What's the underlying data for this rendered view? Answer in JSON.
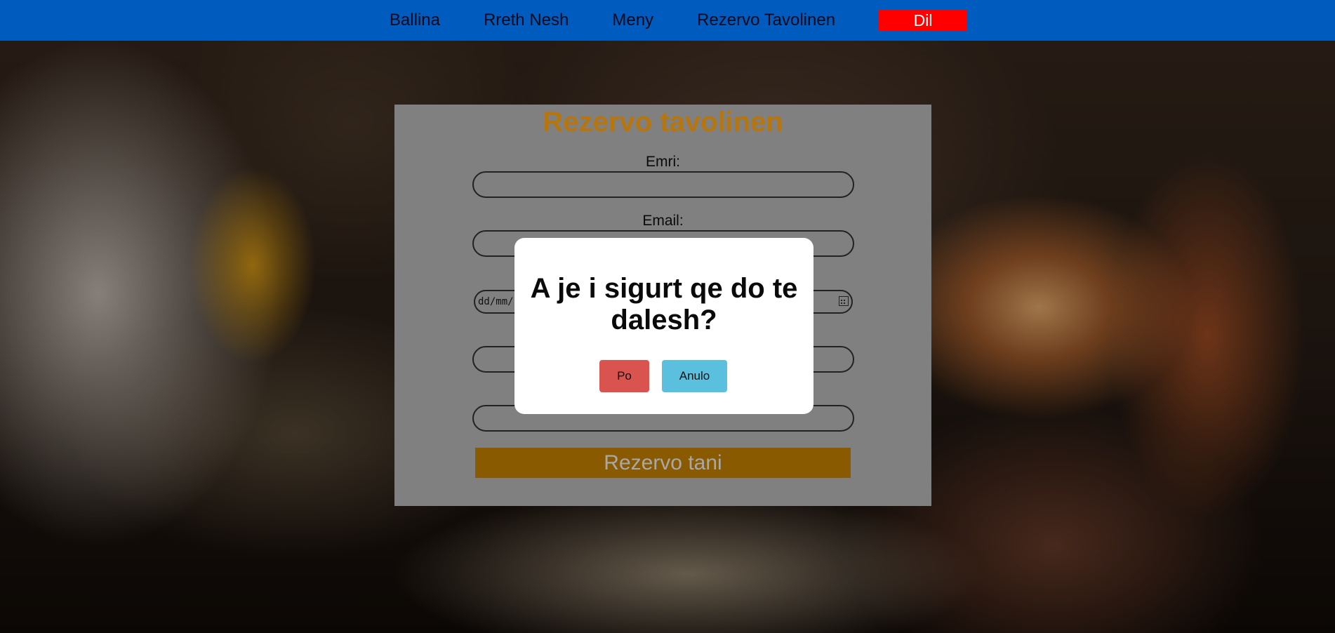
{
  "nav": {
    "items": [
      {
        "label": "Ballina"
      },
      {
        "label": "Rreth Nesh"
      },
      {
        "label": "Meny"
      },
      {
        "label": "Rezervo Tavolinen"
      }
    ],
    "logout_label": "Dil"
  },
  "form": {
    "title": "Rezervo tavolinen",
    "name_label": "Emri:",
    "email_label": "Email:",
    "date_placeholder": "dd/mm/",
    "submit_label": "Rezervo tani"
  },
  "modal": {
    "message": "A je i sigurt qe do te dalesh?",
    "confirm_label": "Po",
    "cancel_label": "Anulo"
  },
  "colors": {
    "navbar": "#005bbf",
    "logout_button": "#ff0000",
    "title": "#b5760f",
    "submit_button": "#8a5a00",
    "confirm_button": "#d9534f",
    "cancel_button": "#5bc0de"
  }
}
